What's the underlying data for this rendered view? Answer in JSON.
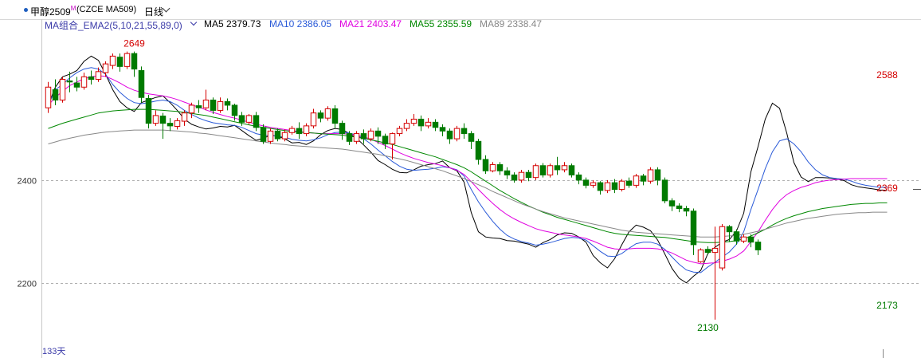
{
  "header": {
    "symbol": "甲醇2509",
    "symbol_sup": "M",
    "code": "(CZCE MA509)",
    "period": "日线"
  },
  "legend": {
    "group": "MA组合_EMA2(5,10,21,55,89,0)",
    "ma5": "MA5 2379.73",
    "ma10": "MA10 2386.05",
    "ma21": "MA21 2403.47",
    "ma55": "MA55 2355.59",
    "ma89": "MA89 2338.47"
  },
  "footer": {
    "days": "133天"
  },
  "colors": {
    "up": "#d40000",
    "down": "#007a00",
    "ma5": "#000000",
    "ma10": "#2a5ad8",
    "ma21": "#e000e0",
    "ma55": "#008800",
    "ma89": "#888888",
    "grid": "#b0b0b0",
    "legend_group": "#3a3aa8"
  },
  "chart_data": {
    "type": "candlestick",
    "y_ticks": [
      "2400",
      "2200"
    ],
    "ylim": [
      2085,
      2690
    ],
    "grid": "horizontal dashed",
    "annotations": [
      {
        "label": "2649",
        "bar": 12,
        "value": 2649
      },
      {
        "label": "2130",
        "bar": 92,
        "value": 2130
      },
      {
        "label": "2369",
        "bar": 119,
        "value": 2369
      },
      {
        "label": "2173",
        "bar": 137,
        "value": 2173
      },
      {
        "label": "2588",
        "bar": 158,
        "value": 2588
      }
    ],
    "series_lines": [
      {
        "name": "MA5",
        "values": [
          2545,
          2580,
          2600,
          2605,
          2612,
          2630,
          2640,
          2632,
          2605,
          2575,
          2552,
          2540,
          2533,
          2550,
          2555,
          2560,
          2563,
          2550,
          2535,
          2518,
          2508,
          2503,
          2499,
          2501,
          2504,
          2503,
          2506,
          2496,
          2486,
          2477,
          2481,
          2487,
          2485,
          2480,
          2472,
          2473,
          2469,
          2476,
          2488,
          2496,
          2500,
          2498,
          2490,
          2481,
          2468,
          2454,
          2438,
          2430,
          2421,
          2415,
          2414,
          2420,
          2427,
          2430,
          2432,
          2437,
          2424,
          2418,
          2396,
          2337,
          2300,
          2290,
          2288,
          2287,
          2283,
          2282,
          2279,
          2276,
          2270,
          2279,
          2285,
          2294,
          2298,
          2297,
          2290,
          2280,
          2254,
          2240,
          2230,
          2248,
          2275,
          2300,
          2313,
          2309,
          2302,
          2284,
          2257,
          2229,
          2210,
          2201,
          2214,
          2225,
          2258,
          2270,
          2280,
          2285,
          2302,
          2336,
          2416,
          2465,
          2518,
          2549,
          2539,
          2491,
          2434,
          2406,
          2397,
          2405,
          2405,
          2404,
          2402,
          2399,
          2391,
          2387,
          2385,
          2383,
          2381,
          2380
        ]
      },
      {
        "name": "MA10",
        "values": [
          2545,
          2575,
          2585,
          2598,
          2608,
          2615,
          2618,
          2615,
          2605,
          2585,
          2570,
          2558,
          2550,
          2548,
          2550,
          2553,
          2555,
          2552,
          2545,
          2535,
          2527,
          2520,
          2515,
          2511,
          2509,
          2507,
          2506,
          2502,
          2496,
          2490,
          2487,
          2486,
          2485,
          2483,
          2479,
          2477,
          2476,
          2478,
          2482,
          2488,
          2492,
          2493,
          2491,
          2487,
          2480,
          2470,
          2458,
          2447,
          2436,
          2427,
          2421,
          2419,
          2420,
          2421,
          2423,
          2426,
          2424,
          2420,
          2408,
          2382,
          2358,
          2338,
          2320,
          2305,
          2293,
          2286,
          2281,
          2278,
          2274,
          2276,
          2279,
          2283,
          2287,
          2289,
          2288,
          2284,
          2273,
          2262,
          2253,
          2252,
          2258,
          2268,
          2277,
          2280,
          2280,
          2276,
          2266,
          2251,
          2237,
          2226,
          2222,
          2221,
          2232,
          2241,
          2251,
          2261,
          2276,
          2300,
          2343,
          2382,
          2422,
          2455,
          2476,
          2480,
          2470,
          2455,
          2435,
          2420,
          2410,
          2405,
          2403,
          2402,
          2398,
          2393,
          2390,
          2388,
          2386,
          2386
        ]
      },
      {
        "name": "MA21",
        "values": [
          2545,
          2560,
          2572,
          2583,
          2590,
          2596,
          2600,
          2602,
          2601,
          2595,
          2588,
          2580,
          2574,
          2570,
          2567,
          2565,
          2563,
          2560,
          2556,
          2551,
          2546,
          2541,
          2536,
          2531,
          2527,
          2523,
          2520,
          2516,
          2512,
          2508,
          2505,
          2502,
          2500,
          2498,
          2496,
          2494,
          2492,
          2491,
          2490,
          2490,
          2490,
          2490,
          2489,
          2487,
          2484,
          2479,
          2473,
          2467,
          2460,
          2453,
          2447,
          2442,
          2438,
          2434,
          2431,
          2428,
          2424,
          2419,
          2411,
          2397,
          2382,
          2368,
          2355,
          2343,
          2333,
          2325,
          2318,
          2312,
          2306,
          2302,
          2299,
          2296,
          2294,
          2292,
          2290,
          2287,
          2282,
          2276,
          2270,
          2267,
          2266,
          2267,
          2268,
          2268,
          2268,
          2267,
          2264,
          2259,
          2252,
          2245,
          2241,
          2238,
          2239,
          2240,
          2243,
          2247,
          2253,
          2263,
          2281,
          2300,
          2322,
          2343,
          2360,
          2372,
          2380,
          2386,
          2390,
          2395,
          2398,
          2400,
          2401,
          2402,
          2403,
          2403,
          2403,
          2403,
          2403,
          2403
        ]
      },
      {
        "name": "MA55",
        "values": [
          2500,
          2505,
          2510,
          2514,
          2518,
          2522,
          2526,
          2530,
          2532,
          2534,
          2535,
          2536,
          2537,
          2537,
          2537,
          2536,
          2535,
          2534,
          2533,
          2531,
          2529,
          2527,
          2525,
          2522,
          2519,
          2516,
          2513,
          2510,
          2507,
          2504,
          2502,
          2500,
          2498,
          2496,
          2494,
          2493,
          2492,
          2491,
          2490,
          2489,
          2488,
          2487,
          2485,
          2483,
          2481,
          2478,
          2475,
          2472,
          2469,
          2465,
          2461,
          2457,
          2453,
          2449,
          2445,
          2440,
          2435,
          2430,
          2424,
          2416,
          2407,
          2398,
          2389,
          2380,
          2372,
          2364,
          2357,
          2350,
          2344,
          2338,
          2333,
          2328,
          2324,
          2320,
          2316,
          2312,
          2308,
          2304,
          2300,
          2297,
          2295,
          2294,
          2293,
          2292,
          2291,
          2290,
          2289,
          2287,
          2285,
          2283,
          2281,
          2280,
          2279,
          2279,
          2280,
          2281,
          2283,
          2286,
          2292,
          2298,
          2305,
          2313,
          2320,
          2326,
          2331,
          2335,
          2339,
          2342,
          2345,
          2347,
          2349,
          2351,
          2353,
          2354,
          2355,
          2355,
          2356,
          2356
        ]
      },
      {
        "name": "MA89",
        "values": [
          2470,
          2474,
          2478,
          2481,
          2484,
          2487,
          2489,
          2491,
          2493,
          2494,
          2495,
          2496,
          2497,
          2497,
          2497,
          2497,
          2497,
          2496,
          2495,
          2494,
          2493,
          2491,
          2490,
          2488,
          2486,
          2484,
          2482,
          2480,
          2478,
          2476,
          2474,
          2472,
          2470,
          2469,
          2467,
          2466,
          2465,
          2464,
          2463,
          2462,
          2461,
          2460,
          2458,
          2456,
          2454,
          2452,
          2450,
          2447,
          2444,
          2441,
          2438,
          2434,
          2430,
          2426,
          2422,
          2418,
          2413,
          2408,
          2403,
          2397,
          2391,
          2385,
          2378,
          2372,
          2366,
          2360,
          2354,
          2349,
          2344,
          2339,
          2335,
          2331,
          2327,
          2324,
          2321,
          2318,
          2315,
          2312,
          2309,
          2306,
          2303,
          2301,
          2299,
          2298,
          2297,
          2296,
          2295,
          2294,
          2293,
          2292,
          2291,
          2290,
          2290,
          2290,
          2291,
          2292,
          2293,
          2295,
          2298,
          2301,
          2305,
          2309,
          2313,
          2317,
          2320,
          2323,
          2326,
          2328,
          2330,
          2332,
          2334,
          2335,
          2336,
          2337,
          2337,
          2338,
          2338,
          2338
        ]
      }
    ],
    "candles": [
      [
        2540,
        2580,
        2530,
        2590
      ],
      [
        2575,
        2555,
        2545,
        2595
      ],
      [
        2555,
        2595,
        2550,
        2600
      ],
      [
        2592,
        2590,
        2570,
        2610
      ],
      [
        2588,
        2580,
        2572,
        2600
      ],
      [
        2580,
        2600,
        2575,
        2608
      ],
      [
        2600,
        2595,
        2585,
        2612
      ],
      [
        2595,
        2610,
        2590,
        2618
      ],
      [
        2608,
        2625,
        2600,
        2630
      ],
      [
        2622,
        2640,
        2615,
        2645
      ],
      [
        2638,
        2620,
        2610,
        2645
      ],
      [
        2620,
        2645,
        2615,
        2649
      ],
      [
        2645,
        2615,
        2600,
        2649
      ],
      [
        2612,
        2560,
        2550,
        2620
      ],
      [
        2558,
        2510,
        2500,
        2565
      ],
      [
        2510,
        2525,
        2505,
        2535
      ],
      [
        2524,
        2510,
        2480,
        2530
      ],
      [
        2510,
        2505,
        2495,
        2520
      ],
      [
        2504,
        2515,
        2498,
        2520
      ],
      [
        2514,
        2530,
        2505,
        2535
      ],
      [
        2530,
        2545,
        2520,
        2550
      ],
      [
        2544,
        2540,
        2530,
        2555
      ],
      [
        2540,
        2555,
        2535,
        2575
      ],
      [
        2555,
        2535,
        2528,
        2560
      ],
      [
        2535,
        2552,
        2530,
        2560
      ],
      [
        2552,
        2545,
        2535,
        2558
      ],
      [
        2545,
        2525,
        2515,
        2548
      ],
      [
        2525,
        2512,
        2505,
        2532
      ],
      [
        2512,
        2525,
        2508,
        2528
      ],
      [
        2525,
        2502,
        2495,
        2532
      ],
      [
        2502,
        2475,
        2470,
        2508
      ],
      [
        2475,
        2495,
        2470,
        2500
      ],
      [
        2495,
        2480,
        2475,
        2500
      ],
      [
        2480,
        2492,
        2475,
        2498
      ],
      [
        2492,
        2500,
        2488,
        2505
      ],
      [
        2500,
        2490,
        2480,
        2512
      ],
      [
        2490,
        2505,
        2485,
        2510
      ],
      [
        2505,
        2530,
        2500,
        2538
      ],
      [
        2530,
        2520,
        2512,
        2535
      ],
      [
        2520,
        2538,
        2515,
        2543
      ],
      [
        2538,
        2510,
        2500,
        2545
      ],
      [
        2510,
        2490,
        2478,
        2515
      ],
      [
        2490,
        2475,
        2468,
        2495
      ],
      [
        2475,
        2490,
        2470,
        2495
      ],
      [
        2490,
        2480,
        2470,
        2498
      ],
      [
        2480,
        2495,
        2475,
        2500
      ],
      [
        2495,
        2485,
        2470,
        2502
      ],
      [
        2485,
        2470,
        2460,
        2490
      ],
      [
        2470,
        2490,
        2440,
        2492
      ],
      [
        2490,
        2500,
        2485,
        2505
      ],
      [
        2500,
        2510,
        2495,
        2518
      ],
      [
        2510,
        2518,
        2505,
        2528
      ],
      [
        2518,
        2505,
        2495,
        2525
      ],
      [
        2505,
        2512,
        2500,
        2520
      ],
      [
        2512,
        2502,
        2495,
        2518
      ],
      [
        2502,
        2495,
        2485,
        2508
      ],
      [
        2495,
        2480,
        2470,
        2500
      ],
      [
        2480,
        2500,
        2475,
        2505
      ],
      [
        2500,
        2490,
        2480,
        2510
      ],
      [
        2490,
        2475,
        2460,
        2495
      ],
      [
        2475,
        2440,
        2430,
        2480
      ],
      [
        2440,
        2418,
        2412,
        2448
      ],
      [
        2418,
        2430,
        2415,
        2435
      ],
      [
        2430,
        2418,
        2410,
        2435
      ],
      [
        2418,
        2410,
        2402,
        2425
      ],
      [
        2410,
        2400,
        2395,
        2415
      ],
      [
        2400,
        2415,
        2395,
        2420
      ],
      [
        2415,
        2405,
        2398,
        2420
      ],
      [
        2405,
        2428,
        2400,
        2432
      ],
      [
        2428,
        2410,
        2405,
        2433
      ],
      [
        2410,
        2428,
        2405,
        2432
      ],
      [
        2428,
        2420,
        2410,
        2445
      ],
      [
        2420,
        2428,
        2415,
        2435
      ],
      [
        2428,
        2410,
        2405,
        2432
      ],
      [
        2410,
        2400,
        2392,
        2415
      ],
      [
        2400,
        2390,
        2384,
        2405
      ],
      [
        2390,
        2395,
        2385,
        2400
      ],
      [
        2395,
        2380,
        2372,
        2398
      ],
      [
        2380,
        2395,
        2375,
        2400
      ],
      [
        2395,
        2382,
        2375,
        2402
      ],
      [
        2382,
        2398,
        2378,
        2402
      ],
      [
        2398,
        2390,
        2385,
        2405
      ],
      [
        2390,
        2408,
        2385,
        2412
      ],
      [
        2408,
        2398,
        2390,
        2412
      ],
      [
        2398,
        2420,
        2393,
        2425
      ],
      [
        2420,
        2400,
        2390,
        2425
      ],
      [
        2400,
        2360,
        2355,
        2405
      ],
      [
        2360,
        2350,
        2340,
        2365
      ],
      [
        2350,
        2345,
        2338,
        2355
      ],
      [
        2345,
        2340,
        2330,
        2350
      ],
      [
        2340,
        2275,
        2255,
        2345
      ],
      [
        2242,
        2265,
        2240,
        2268
      ],
      [
        2266,
        2260,
        2256,
        2272
      ],
      [
        2260,
        2268,
        2130,
        2310
      ],
      [
        2230,
        2310,
        2225,
        2315
      ],
      [
        2310,
        2300,
        2280,
        2313
      ],
      [
        2300,
        2282,
        2275,
        2305
      ],
      [
        2282,
        2290,
        2278,
        2295
      ],
      [
        2290,
        2280,
        2270,
        2295
      ],
      [
        2280,
        2265,
        2255,
        2285
      ]
    ]
  }
}
